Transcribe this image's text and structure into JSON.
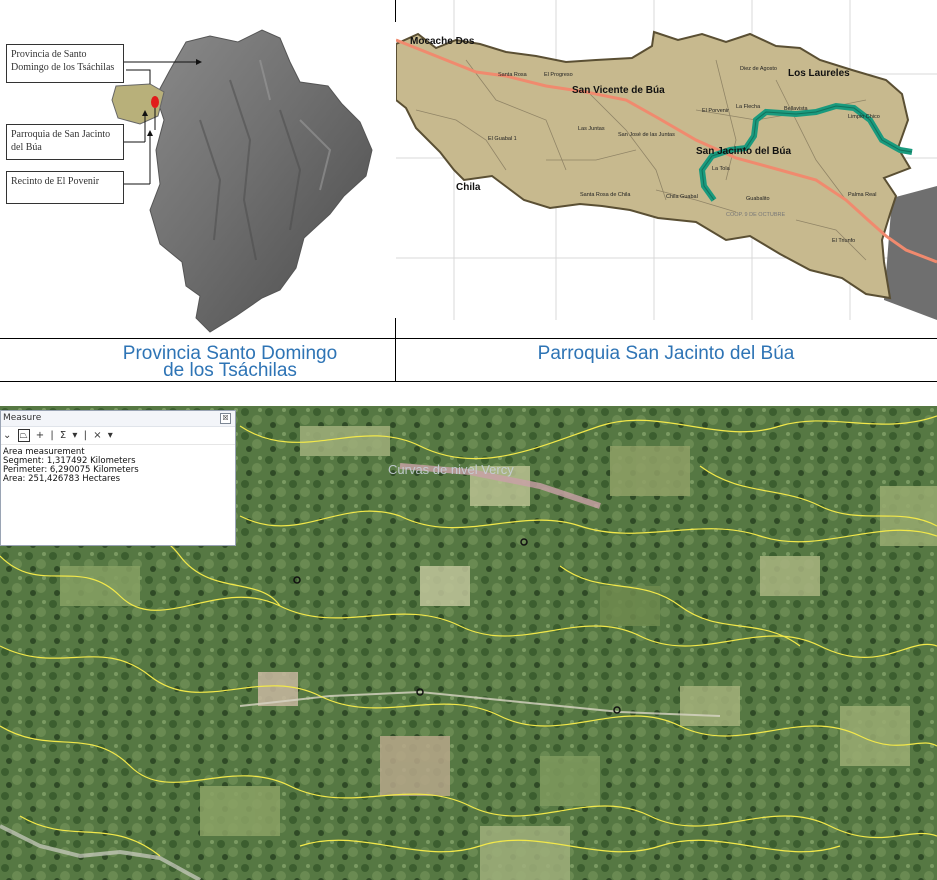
{
  "left_panel": {
    "caption": "Provincia Santo Domingo de los Tsáchilas",
    "callouts": [
      "Provincia de Santo Domingo de los Tsáchilas",
      "Parroquia de San Jacinto del Búa",
      "Recinto de El Povenir"
    ]
  },
  "right_panel": {
    "caption": "Parroquia San Jacinto del Búa",
    "places_major": [
      "Mocache Dos",
      "San Vicente de Búa",
      "Los Laureles",
      "San Jacinto del Búa",
      "Chila"
    ],
    "places_minor": [
      "Santa Rosa",
      "El Progreso",
      "Diez de Agosto",
      "El Porvenir",
      "La Flecha",
      "Bellavista",
      "Limpio Chico",
      "Las Juntas",
      "San José de las Juntas",
      "El Guabal 1",
      "La Tola",
      "Santa Rosa de Chila",
      "Chila Guabal",
      "Guabalito",
      "COOP. 9 DE OCTUBRE",
      "Palma Real",
      "El Triunfo"
    ]
  },
  "measure_window": {
    "title": "Measure",
    "close_glyph": "☒",
    "toolbar": [
      "⌄",
      "⏢",
      "+",
      "|",
      "Σ",
      "▾",
      "|",
      "×",
      "▾"
    ],
    "results": [
      "Area measurement",
      "Segment: 1,317492 Kilometers",
      "Perimeter: 6,290075 Kilometers",
      "Area: 251,426783 Hectares"
    ]
  },
  "aerial": {
    "overlay_label": "Curvas de nivel Vercy"
  },
  "colors": {
    "caption_blue": "#2e74b5",
    "parish_fill": "#c7b98e",
    "river": "#1a9a7e",
    "road": "#f08a6e",
    "contour": "#f2e84a"
  }
}
